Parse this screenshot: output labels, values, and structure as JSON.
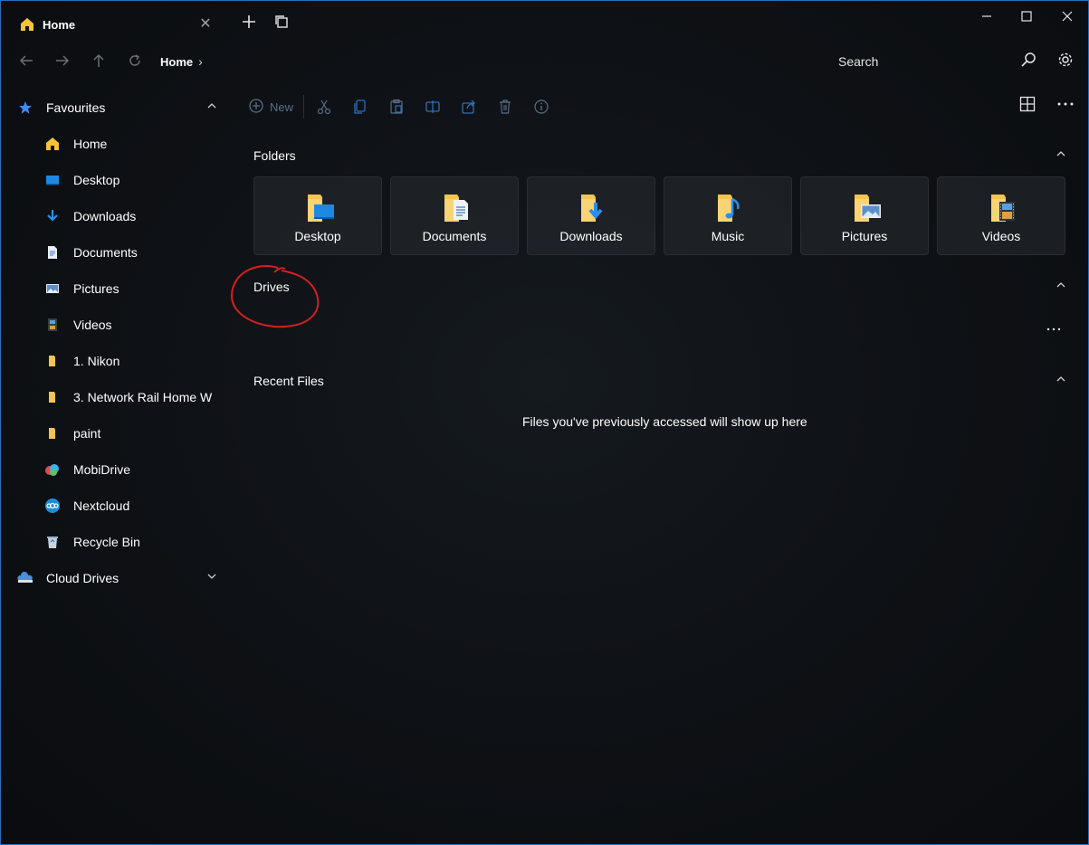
{
  "tab": {
    "title": "Home",
    "icon": "home-icon"
  },
  "address": {
    "breadcrumb": "Home",
    "search_label": "Search"
  },
  "toolbar": {
    "new_label": "New"
  },
  "sidebar": {
    "favourites": "Favourites",
    "items": [
      {
        "label": "Home",
        "icon": "home-icon"
      },
      {
        "label": "Desktop",
        "icon": "desktop-icon"
      },
      {
        "label": "Downloads",
        "icon": "download-icon"
      },
      {
        "label": "Documents",
        "icon": "document-icon"
      },
      {
        "label": "Pictures",
        "icon": "picture-icon"
      },
      {
        "label": "Videos",
        "icon": "video-icon"
      },
      {
        "label": "1. Nikon",
        "icon": "folder-icon"
      },
      {
        "label": "3. Network Rail Home W",
        "icon": "folder-icon"
      },
      {
        "label": "paint",
        "icon": "folder-icon"
      },
      {
        "label": "MobiDrive",
        "icon": "mobidrive-icon"
      },
      {
        "label": "Nextcloud",
        "icon": "nextcloud-icon"
      },
      {
        "label": "Recycle Bin",
        "icon": "recycle-bin-icon"
      }
    ],
    "cloud_drives": "Cloud Drives"
  },
  "sections": {
    "folders": "Folders",
    "drives": "Drives",
    "recent": "Recent Files",
    "recent_empty": "Files you've previously accessed will show up here"
  },
  "folders": [
    {
      "label": "Desktop",
      "icon": "desktop-folder-icon"
    },
    {
      "label": "Documents",
      "icon": "documents-folder-icon"
    },
    {
      "label": "Downloads",
      "icon": "downloads-folder-icon"
    },
    {
      "label": "Music",
      "icon": "music-folder-icon"
    },
    {
      "label": "Pictures",
      "icon": "pictures-folder-icon"
    },
    {
      "label": "Videos",
      "icon": "videos-folder-icon"
    }
  ],
  "colors": {
    "accent": "#2b6fb3",
    "folder": "#f5c451",
    "annotation": "#d42020",
    "home_icon": "#f7c436"
  }
}
